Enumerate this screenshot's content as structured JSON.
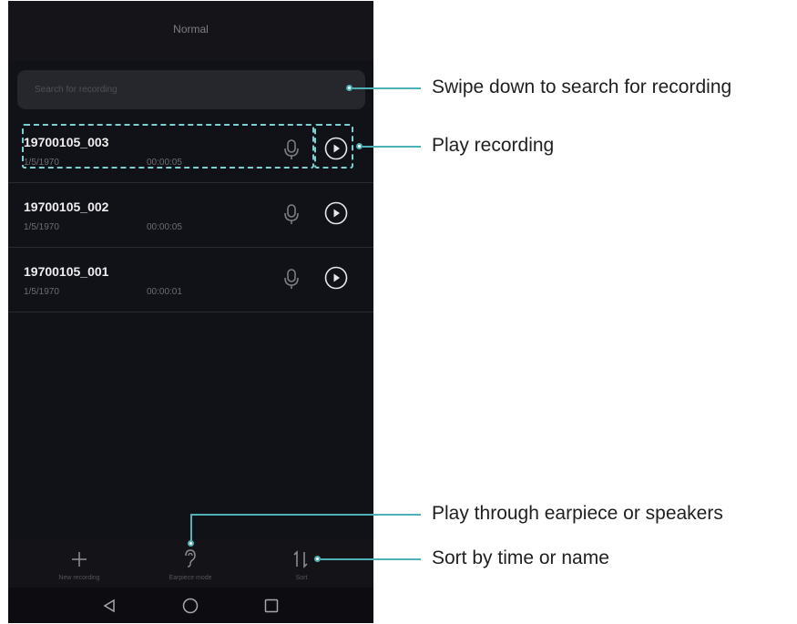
{
  "header": {
    "title": "Normal"
  },
  "search": {
    "placeholder": "Search for recording"
  },
  "recordings": [
    {
      "name": "19700105_003",
      "date": "1/5/1970",
      "duration": "00:00:05"
    },
    {
      "name": "19700105_002",
      "date": "1/5/1970",
      "duration": "00:00:05"
    },
    {
      "name": "19700105_001",
      "date": "1/5/1970",
      "duration": "00:00:01"
    }
  ],
  "bottom_bar": {
    "new_recording": "New recording",
    "earpiece_mode": "Earpiece mode",
    "sort": "Sort"
  },
  "callouts": {
    "search": "Swipe down to search for recording",
    "play": "Play recording",
    "earpiece": "Play through earpiece or speakers",
    "sort": "Sort by time or name"
  },
  "colors": {
    "callout": "#4fb1b5",
    "highlight": "#7bd0d1",
    "background": "#111118"
  }
}
